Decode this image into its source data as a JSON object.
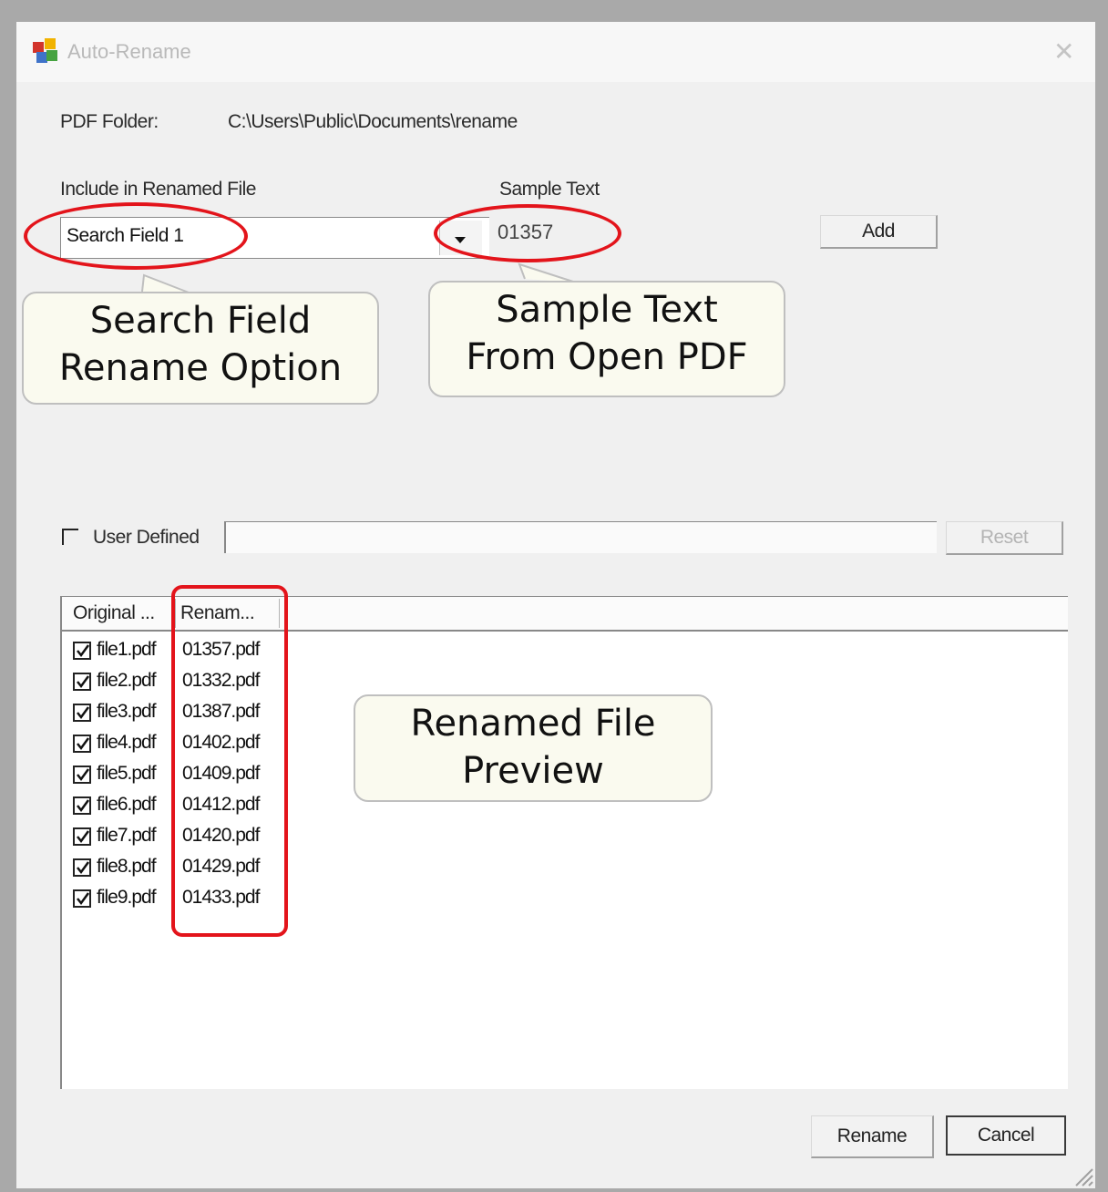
{
  "window": {
    "title": "Auto-Rename",
    "close_glyph": "✕"
  },
  "folder": {
    "label": "PDF Folder:",
    "path": "C:\\Users\\Public\\Documents\\rename"
  },
  "include": {
    "label": "Include in Renamed File",
    "selected": "Search Field 1"
  },
  "sample": {
    "label": "Sample Text",
    "value": "01357"
  },
  "buttons": {
    "add": "Add",
    "reset": "Reset",
    "rename": "Rename",
    "cancel": "Cancel"
  },
  "user_defined": {
    "label": "User Defined",
    "checked": false,
    "value": ""
  },
  "list": {
    "columns": [
      "Original ...",
      "Renam..."
    ],
    "rows": [
      {
        "checked": true,
        "original": "file1.pdf",
        "renamed": "01357.pdf"
      },
      {
        "checked": true,
        "original": "file2.pdf",
        "renamed": "01332.pdf"
      },
      {
        "checked": true,
        "original": "file3.pdf",
        "renamed": "01387.pdf"
      },
      {
        "checked": true,
        "original": "file4.pdf",
        "renamed": "01402.pdf"
      },
      {
        "checked": true,
        "original": "file5.pdf",
        "renamed": "01409.pdf"
      },
      {
        "checked": true,
        "original": "file6.pdf",
        "renamed": "01412.pdf"
      },
      {
        "checked": true,
        "original": "file7.pdf",
        "renamed": "01420.pdf"
      },
      {
        "checked": true,
        "original": "file8.pdf",
        "renamed": "01429.pdf"
      },
      {
        "checked": true,
        "original": "file9.pdf",
        "renamed": "01433.pdf"
      }
    ]
  },
  "callouts": {
    "search_field": [
      "Search Field",
      "Rename Option"
    ],
    "sample_text": [
      "Sample Text",
      "From Open PDF"
    ],
    "renamed_preview": [
      "Renamed File",
      "Preview"
    ]
  },
  "colors": {
    "highlight": "#e3141b",
    "callout_bg": "#fafaef",
    "window_bg": "#f0f0f0"
  },
  "icons": {
    "app": "app-icon",
    "close": "close-icon",
    "dropdown": "chevron-down-icon",
    "grip": "resize-grip-icon"
  }
}
